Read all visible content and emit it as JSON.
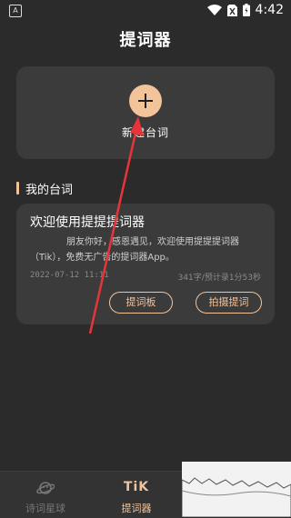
{
  "status_bar": {
    "left_icon_text": "A",
    "time": "4:42"
  },
  "header": {
    "title": "提词器"
  },
  "new_script": {
    "label": "新建台词"
  },
  "my_scripts": {
    "section_title": "我的台词",
    "items": [
      {
        "title": "欢迎使用提提提词器",
        "excerpt": "朋友你好，感恩遇见，欢迎使用提提提词器（Tik），免费无广告的提词器App。",
        "date": "2022-07-12 11:11",
        "meta": "341字/预计录1分53秒",
        "teleprompter_button": "提词板",
        "record_button": "拍摄提词"
      }
    ]
  },
  "bottom_nav": {
    "items": [
      {
        "label": "诗词星球",
        "icon": "planet-icon",
        "active": false
      },
      {
        "label": "提词器",
        "icon_text": "TiK",
        "active": true
      }
    ]
  },
  "colors": {
    "accent": "#f3c39a",
    "background": "#2b2b2b",
    "card": "#3b3b3b",
    "arrow": "#e5353a"
  }
}
